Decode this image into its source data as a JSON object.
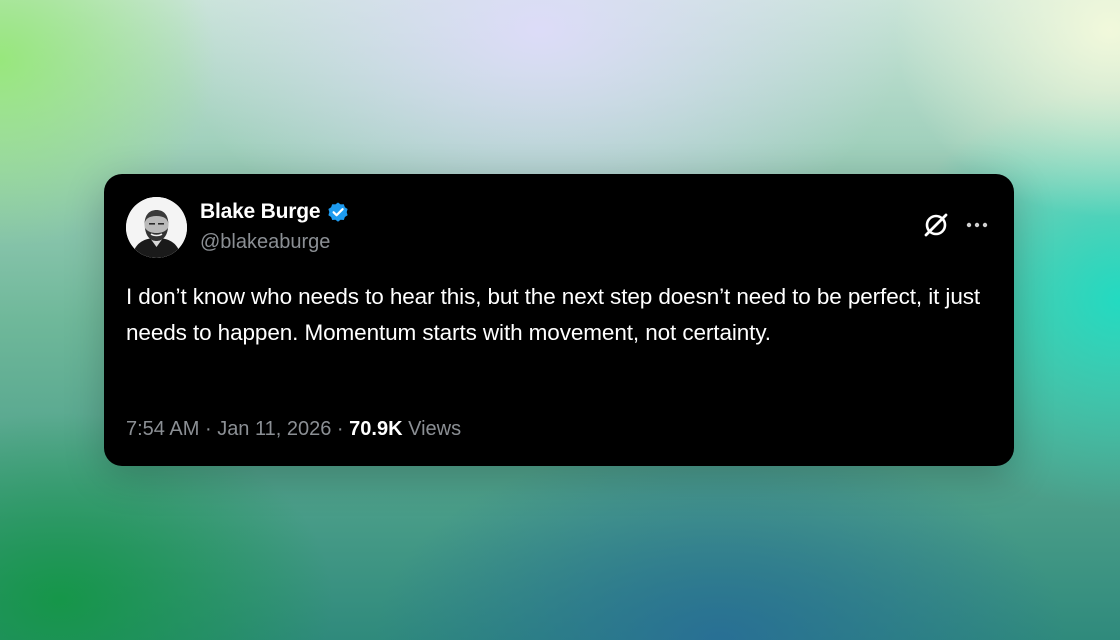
{
  "tweet": {
    "author": {
      "display_name": "Blake Burge",
      "handle": "@blakeaburge",
      "verified": true
    },
    "text": "I don’t know who needs to hear this, but the next step doesn’t need to be perfect, it just needs to happen. Momentum starts with movement, not certainty.",
    "time": "7:54 AM",
    "date": "Jan 11, 2026",
    "separator": "·",
    "views_count": "70.9K",
    "views_label": "Views"
  },
  "icons": {
    "verified": "verified-badge-icon",
    "brand": "x-logo-icon",
    "more": "more-options-icon"
  },
  "colors": {
    "card_background": "#000000",
    "text_primary": "#ffffff",
    "text_secondary": "#8b8f94",
    "verified_blue": "#1d9bf0"
  }
}
